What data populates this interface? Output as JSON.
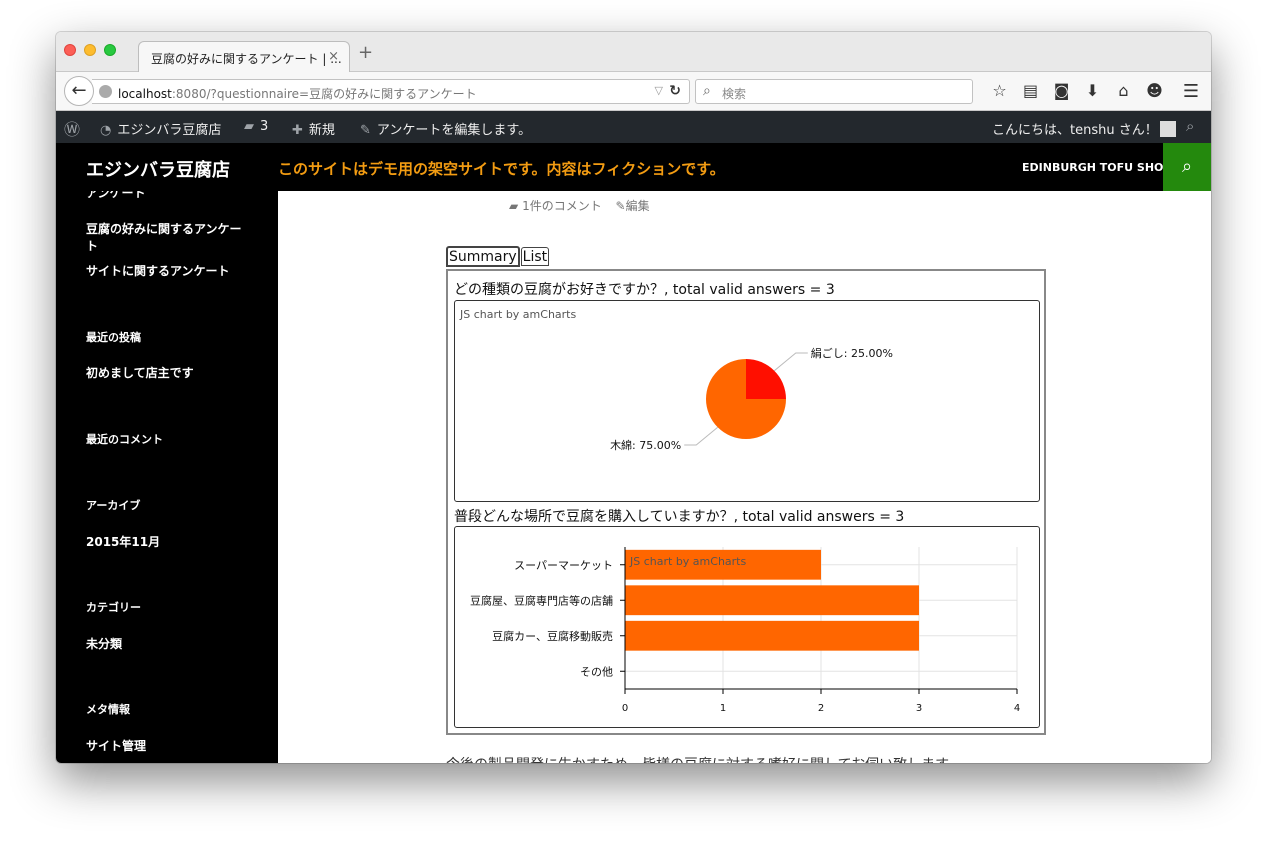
{
  "browser": {
    "tab_title": "豆腐の好みに関するアンケート | ...",
    "tab_close": "×",
    "new_tab": "+",
    "url_host": "localhost",
    "url_rest": ":8080/?questionnaire=豆腐の好みに関するアンケート",
    "search_placeholder": "検索",
    "icons": [
      "star-icon",
      "reading-list-icon",
      "pocket-icon",
      "download-icon",
      "home-icon",
      "emoji-icon",
      "menu-icon"
    ]
  },
  "admin_bar": {
    "site_name": "エジンバラ豆腐店",
    "comments_count": "3",
    "new_label": "新規",
    "edit_label": "アンケートを編集します。",
    "greeting": "こんにちは、tenshu さん！"
  },
  "site": {
    "title": "エジンバラ豆腐店",
    "notice": "このサイトはデモ用の架空サイトです。内容はフィクションです。",
    "shop_name": "EDINBURGH TOFU SHOP"
  },
  "sidebar": {
    "cut_heading": "アンケート",
    "survey_links": [
      "豆腐の好みに関するアンケート",
      "サイトに関するアンケート"
    ],
    "recent_posts_heading": "最近の投稿",
    "recent_post": "初めまして店主です",
    "recent_comments_heading": "最近のコメント",
    "archive_heading": "アーカイブ",
    "archive_item": "2015年11月",
    "category_heading": "カテゴリー",
    "category_item": "未分類",
    "meta_heading": "メタ情報",
    "meta_item": "サイト管理"
  },
  "post": {
    "comments_link": "1件のコメント",
    "edit_link": "編集",
    "tabs": [
      "Summary",
      "List"
    ],
    "trailing_text": "今後の製品開発に生かすため、皆様の豆腐に対する嗜好に関してお伺い致します"
  },
  "chart_data": [
    {
      "type": "pie",
      "title": "どの種類の豆腐がお好きですか？, total valid answers = 3",
      "credit": "JS chart by amCharts",
      "slices": [
        {
          "label": "絹ごし: 25.00%",
          "value": 25.0,
          "color": "#ff0f00"
        },
        {
          "label": "木綿: 75.00%",
          "value": 75.0,
          "color": "#ff6600"
        }
      ]
    },
    {
      "type": "bar",
      "orientation": "horizontal",
      "title": "普段どんな場所で豆腐を購入していますか？, total valid answers = 3",
      "credit": "JS chart by amCharts",
      "categories": [
        "スーパーマーケット",
        "豆腐屋、豆腐専門店等の店舗",
        "豆腐カー、豆腐移動販売",
        "その他"
      ],
      "values": [
        2,
        3,
        3,
        0
      ],
      "xlim": [
        0,
        4
      ],
      "xticks": [
        "0",
        "1",
        "2",
        "3",
        "4"
      ],
      "grid": true,
      "color": "#ff6600"
    }
  ]
}
